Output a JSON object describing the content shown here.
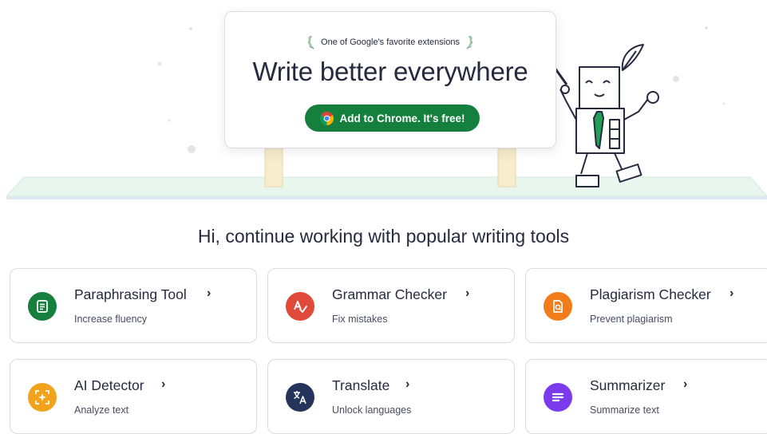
{
  "hero": {
    "badge_text": "One of Google's favorite extensions",
    "headline": "Write better everywhere",
    "cta_label": "Add to Chrome. It's free!"
  },
  "subtitle": "Hi, continue working with popular writing tools",
  "tools": [
    {
      "title": "Paraphrasing Tool",
      "desc": "Increase fluency",
      "icon": "paraphrase-icon",
      "color": "#15803d"
    },
    {
      "title": "Grammar Checker",
      "desc": "Fix mistakes",
      "icon": "grammar-icon",
      "color": "#e04a3a"
    },
    {
      "title": "Plagiarism Checker",
      "desc": "Prevent plagiarism",
      "icon": "plagiarism-icon",
      "color": "#f07d1a"
    },
    {
      "title": "AI Detector",
      "desc": "Analyze text",
      "icon": "ai-detector-icon",
      "color": "#f3a21c"
    },
    {
      "title": "Translate",
      "desc": "Unlock languages",
      "icon": "translate-icon",
      "color": "#24345a"
    },
    {
      "title": "Summarizer",
      "desc": "Summarize text",
      "icon": "summarizer-icon",
      "color": "#7c3aed"
    }
  ],
  "chevron": "›"
}
